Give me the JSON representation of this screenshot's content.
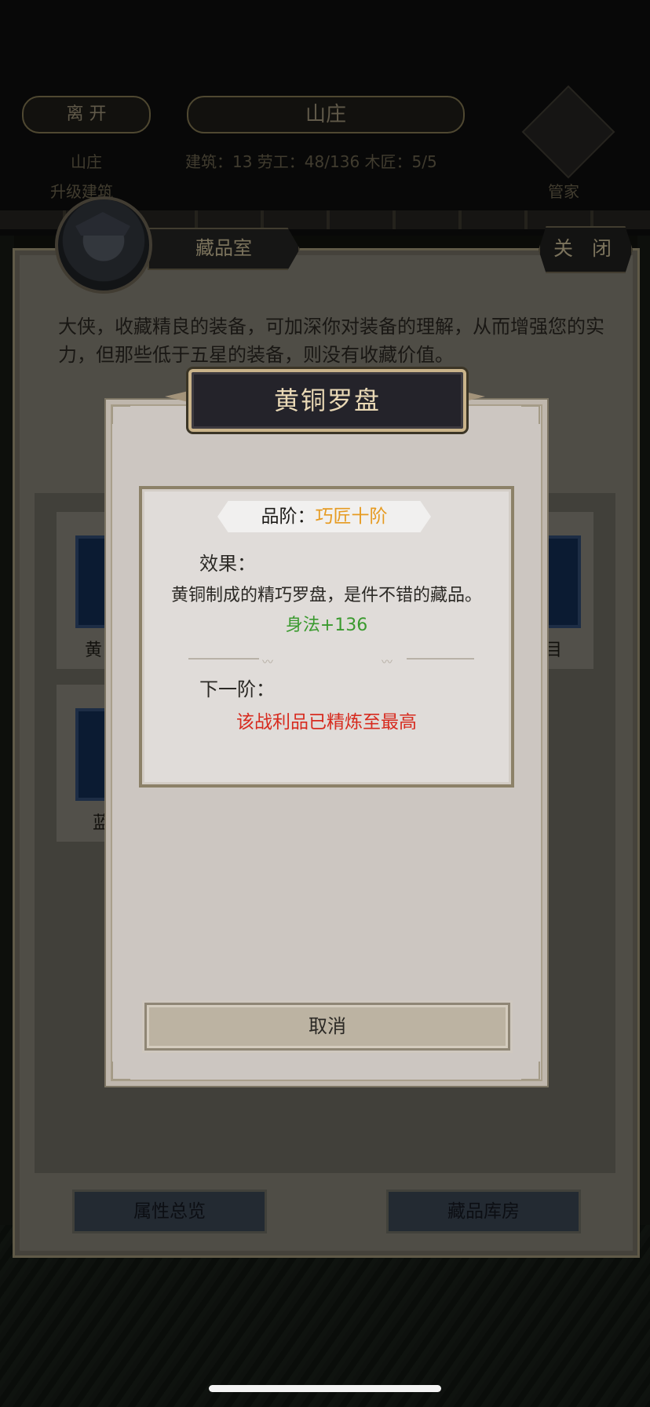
{
  "hud": {
    "leave_label": "离 开",
    "manor_title": "山庄",
    "manor_sub": "山庄",
    "manor_sub2": "升级建筑",
    "stats": "建筑：13    劳工：48/136    木匠：5/5",
    "steward_label": "管家"
  },
  "panel": {
    "tab_title": "藏品室",
    "close_label": "关 闭",
    "intro": "大侠，收藏精良的装备，可加深你对装备的理解，从而增强您的实力，但那些低于五星的装备，则没有收藏价值。",
    "cards": [
      {
        "label": "黄"
      },
      {
        "label": "目"
      },
      {
        "label": "蓝"
      }
    ],
    "attr_overview_label": "属性总览",
    "storage_label": "藏品库房"
  },
  "modal": {
    "title": "黄铜罗盘",
    "grade_label": "品阶：",
    "grade_value": "巧匠十阶",
    "effect_label": "效果：",
    "effect_desc": "黄铜制成的精巧罗盘，是件不错的藏品。",
    "effect_stat": "身法+136",
    "next_label": "下一阶：",
    "next_text": "该战利品已精炼至最高",
    "cancel_label": "取消"
  },
  "colors": {
    "grade_value": "#e69b22",
    "stat": "#3a9a2e",
    "next_text": "#d72b1f",
    "title_text": "#e9d8b5"
  }
}
